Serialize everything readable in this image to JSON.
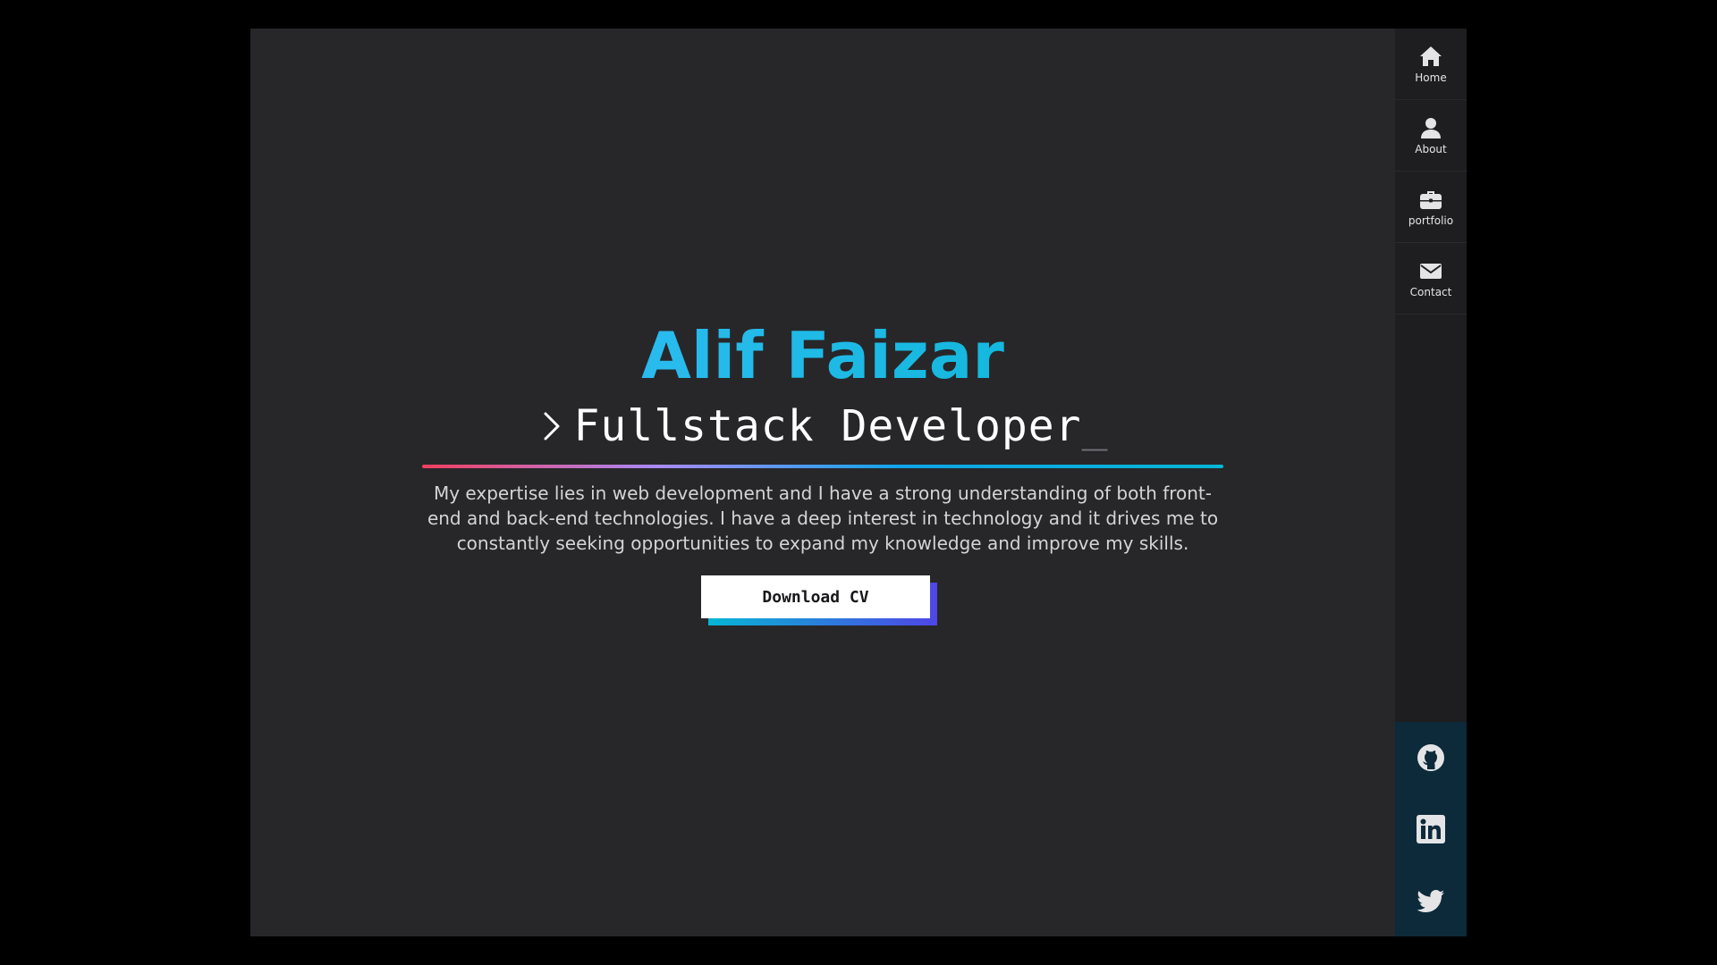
{
  "hero": {
    "name": "Alif Faizar",
    "prompt_icon": "chevron-right-icon",
    "role": "Fullstack Developer",
    "cursor": "_",
    "description": "My expertise lies in web development and I have a strong understanding of both front-end and back-end technologies. I have a deep interest in technology and it drives me to constantly seeking opportunities to expand my knowledge and improve my skills.",
    "cv_button": "Download CV"
  },
  "nav": {
    "items": [
      {
        "label": "Home",
        "icon": "home-icon"
      },
      {
        "label": "About",
        "icon": "user-icon"
      },
      {
        "label": "portfolio",
        "icon": "briefcase-icon"
      },
      {
        "label": "Contact",
        "icon": "envelope-icon"
      }
    ]
  },
  "social": {
    "items": [
      {
        "icon": "github-icon"
      },
      {
        "icon": "linkedin-icon"
      },
      {
        "icon": "twitter-icon"
      }
    ]
  },
  "colors": {
    "page_bg": "#000000",
    "app_bg": "#27272a",
    "sidebar_bg": "#1e1e20",
    "social_bg": "#0c2a3a",
    "name_accent": "#22b7ea",
    "gradient_start": "#f43f5e",
    "gradient_end": "#06b6d4",
    "button_shadow_start": "#06b6d4",
    "button_shadow_end": "#4f46e5"
  }
}
